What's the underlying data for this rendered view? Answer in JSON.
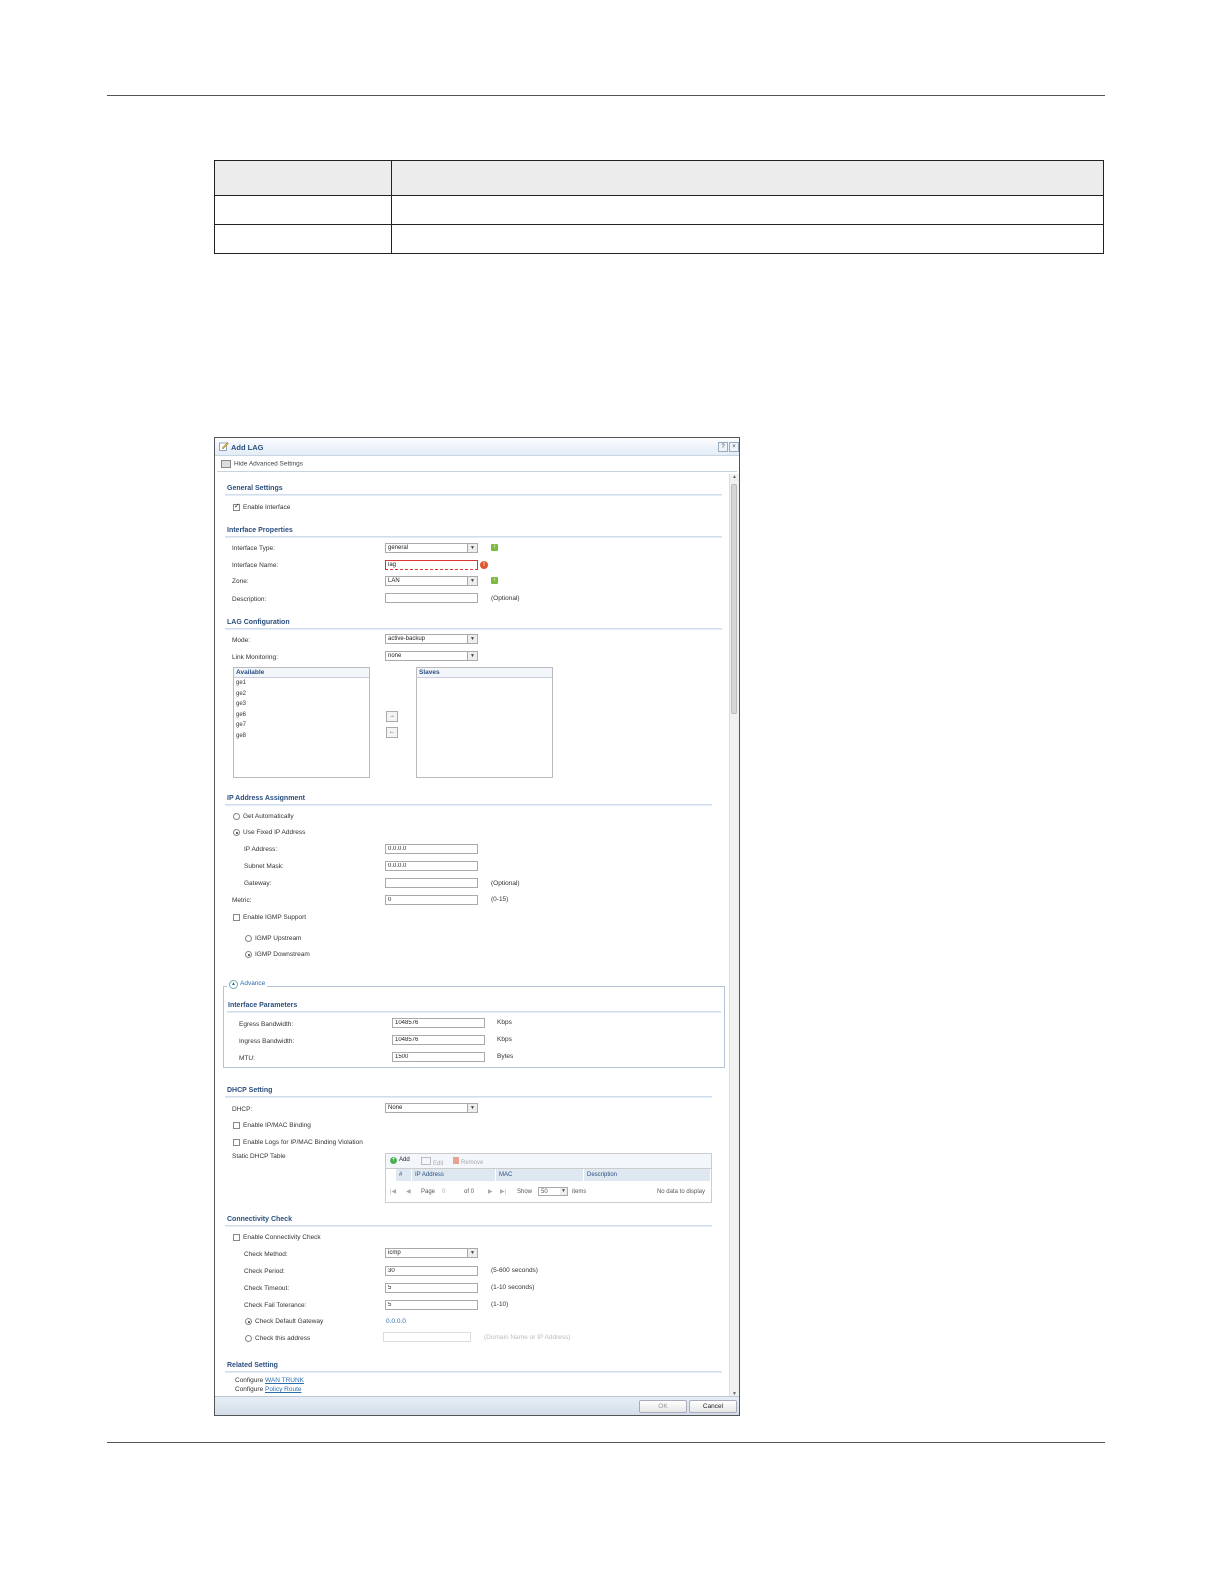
{
  "dialog": {
    "title": "Add LAG",
    "help_label": "?",
    "close_label": "×",
    "advanced_toggle": "Hide Advanced Settings",
    "general": {
      "heading": "General Settings",
      "enable_interface": "Enable Interface"
    },
    "interface_properties": {
      "heading": "Interface Properties",
      "type_label": "Interface Type:",
      "type_value": "general",
      "name_label": "Interface Name:",
      "name_value": "lag",
      "zone_label": "Zone:",
      "zone_value": "LAN",
      "description_label": "Description:",
      "description_value": "",
      "optional": "(Optional)"
    },
    "lag": {
      "heading": "LAG Configuration",
      "mode_label": "Mode:",
      "mode_value": "active-backup",
      "link_label": "Link Monitoring:",
      "link_value": "none",
      "available_header": "Available",
      "available_items": [
        "ge1",
        "ge2",
        "ge3",
        "ge6",
        "ge7",
        "ge8"
      ],
      "slaves_header": "Slaves",
      "add_arrow": "→",
      "remove_arrow": "←"
    },
    "ip": {
      "heading": "IP Address Assignment",
      "get_auto": "Get Automatically",
      "use_fixed": "Use Fixed IP Address",
      "ip_label": "IP Address:",
      "ip_value": "0.0.0.0",
      "mask_label": "Subnet Mask:",
      "mask_value": "0.0.0.0",
      "gw_label": "Gateway:",
      "gw_value": "",
      "gw_optional": "(Optional)",
      "metric_label": "Metric:",
      "metric_value": "0",
      "metric_range": "(0-15)",
      "igmp_label": "Enable IGMP Support",
      "igmp_up": "IGMP Upstream",
      "igmp_down": "IGMP Downstream"
    },
    "advance": {
      "label": "Advance",
      "params_heading": "Interface Parameters",
      "egress_label": "Egress Bandwidth:",
      "egress_value": "1048576",
      "ingress_label": "Ingress Bandwidth:",
      "ingress_value": "1048576",
      "mtu_label": "MTU:",
      "mtu_value": "1500",
      "kbps": "Kbps",
      "bytes": "Bytes"
    },
    "dhcp": {
      "heading": "DHCP Setting",
      "dhcp_label": "DHCP:",
      "dhcp_value": "None",
      "enable_binding": "Enable IP/MAC Binding",
      "enable_logs": "Enable Logs for IP/MAC Binding Violation",
      "static_label": "Static DHCP Table",
      "add": "Add",
      "edit": "Edit",
      "remove": "Remove",
      "columns": [
        "#",
        "IP Address",
        "MAC",
        "Description"
      ],
      "page_label": "Page",
      "page_value": "0",
      "of_label": "of 0",
      "show_label": "Show",
      "show_value": "50",
      "items_label": "items",
      "no_data": "No data to display"
    },
    "connectivity": {
      "heading": "Connectivity Check",
      "enable": "Enable Connectivity Check",
      "method_label": "Check Method:",
      "method_value": "icmp",
      "period_label": "Check Period:",
      "period_value": "30",
      "period_range": "(5-600 seconds)",
      "timeout_label": "Check Timeout:",
      "timeout_value": "5",
      "timeout_range": "(1-10 seconds)",
      "fail_label": "Check Fail Tolerance:",
      "fail_value": "5",
      "fail_range": "(1-10)",
      "default_gw": "Check Default Gateway",
      "default_gw_value": "0.0.0.0",
      "this_address": "Check this address",
      "this_address_hint": "(Domain Name or IP Address)"
    },
    "related": {
      "heading": "Related Setting",
      "configure1": "Configure",
      "link1": "WAN TRUNK",
      "configure2": "Configure",
      "link2": "Policy Route"
    },
    "footer": {
      "ok": "OK",
      "cancel": "Cancel"
    }
  }
}
